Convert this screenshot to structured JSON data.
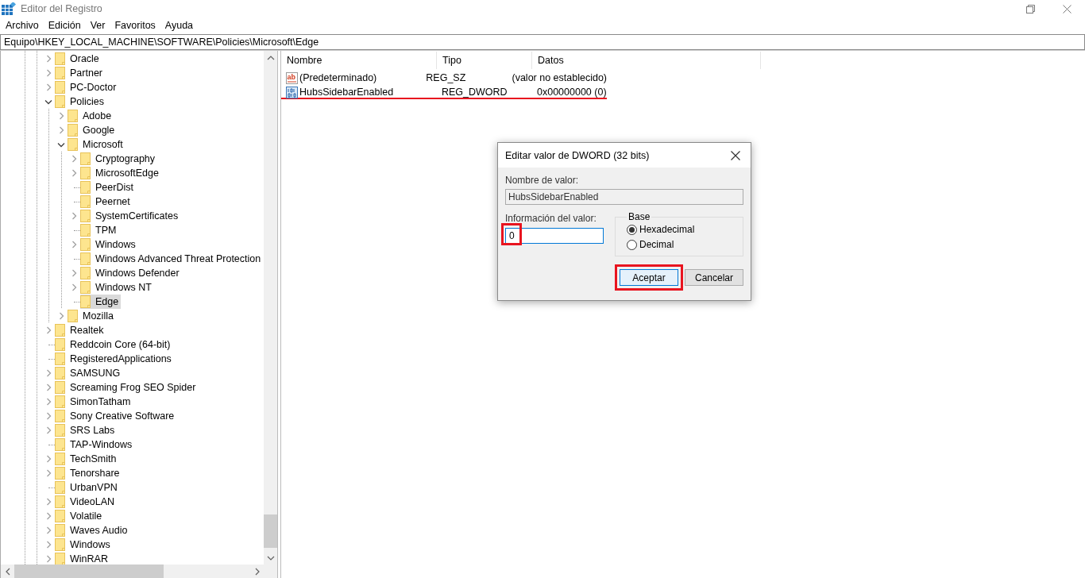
{
  "window": {
    "title": "Editor del Registro"
  },
  "menu": [
    "Archivo",
    "Edición",
    "Ver",
    "Favoritos",
    "Ayuda"
  ],
  "address": "Equipo\\HKEY_LOCAL_MACHINE\\SOFTWARE\\Policies\\Microsoft\\Edge",
  "tree": [
    {
      "label": "Oracle",
      "kind": "collapsed",
      "selected": false
    },
    {
      "label": "Partner",
      "kind": "collapsed",
      "selected": false
    },
    {
      "label": "PC-Doctor",
      "kind": "collapsed",
      "selected": false
    },
    {
      "label": "Policies",
      "kind": "expanded",
      "selected": false,
      "children": [
        {
          "label": "Adobe",
          "kind": "collapsed",
          "selected": false
        },
        {
          "label": "Google",
          "kind": "collapsed",
          "selected": false
        },
        {
          "label": "Microsoft",
          "kind": "expanded",
          "selected": false,
          "children": [
            {
              "label": "Cryptography",
              "kind": "collapsed",
              "selected": false
            },
            {
              "label": "MicrosoftEdge",
              "kind": "collapsed",
              "selected": false
            },
            {
              "label": "PeerDist",
              "kind": "leaf",
              "selected": false
            },
            {
              "label": "Peernet",
              "kind": "leaf",
              "selected": false
            },
            {
              "label": "SystemCertificates",
              "kind": "collapsed",
              "selected": false
            },
            {
              "label": "TPM",
              "kind": "leaf",
              "selected": false
            },
            {
              "label": "Windows",
              "kind": "collapsed",
              "selected": false
            },
            {
              "label": "Windows Advanced Threat Protection",
              "kind": "leaf",
              "selected": false
            },
            {
              "label": "Windows Defender",
              "kind": "collapsed",
              "selected": false
            },
            {
              "label": "Windows NT",
              "kind": "collapsed",
              "selected": false
            },
            {
              "label": "Edge",
              "kind": "leaf",
              "selected": true
            }
          ]
        },
        {
          "label": "Mozilla",
          "kind": "collapsed",
          "selected": false
        }
      ]
    },
    {
      "label": "Realtek",
      "kind": "collapsed",
      "selected": false
    },
    {
      "label": "Reddcoin Core (64-bit)",
      "kind": "leaf",
      "selected": false
    },
    {
      "label": "RegisteredApplications",
      "kind": "leaf",
      "selected": false
    },
    {
      "label": "SAMSUNG",
      "kind": "collapsed",
      "selected": false
    },
    {
      "label": "Screaming Frog SEO Spider",
      "kind": "collapsed",
      "selected": false
    },
    {
      "label": "SimonTatham",
      "kind": "collapsed",
      "selected": false
    },
    {
      "label": "Sony Creative Software",
      "kind": "collapsed",
      "selected": false
    },
    {
      "label": "SRS Labs",
      "kind": "collapsed",
      "selected": false
    },
    {
      "label": "TAP-Windows",
      "kind": "leaf",
      "selected": false
    },
    {
      "label": "TechSmith",
      "kind": "collapsed",
      "selected": false
    },
    {
      "label": "Tenorshare",
      "kind": "collapsed",
      "selected": false
    },
    {
      "label": "UrbanVPN",
      "kind": "leaf",
      "selected": false
    },
    {
      "label": "VideoLAN",
      "kind": "collapsed",
      "selected": false
    },
    {
      "label": "Volatile",
      "kind": "collapsed",
      "selected": false
    },
    {
      "label": "Waves Audio",
      "kind": "collapsed",
      "selected": false
    },
    {
      "label": "Windows",
      "kind": "collapsed",
      "selected": false
    },
    {
      "label": "WinRAR",
      "kind": "collapsed",
      "selected": false
    }
  ],
  "values": {
    "columns": [
      "Nombre",
      "Tipo",
      "Datos"
    ],
    "rows": [
      {
        "kind": "string",
        "icon_text": "ab",
        "name": "(Predeterminado)",
        "type": "REG_SZ",
        "data": "(valor no establecido)",
        "underlined": false
      },
      {
        "kind": "binary",
        "name": "HubsSidebarEnabled",
        "type": "REG_DWORD",
        "data": "0x00000000 (0)",
        "underlined": true
      }
    ]
  },
  "dialog": {
    "title": "Editar valor de DWORD (32 bits)",
    "name_label": "Nombre de valor:",
    "name_value": "HubsSidebarEnabled",
    "data_label": "Información del valor:",
    "data_value": "0",
    "data_highlighted": true,
    "base_label": "Base",
    "base_options": [
      {
        "label": "Hexadecimal",
        "selected": true
      },
      {
        "label": "Decimal",
        "selected": false
      }
    ],
    "buttons": [
      {
        "label": "Aceptar",
        "default": true,
        "highlighted": true
      },
      {
        "label": "Cancelar",
        "default": false,
        "highlighted": false
      }
    ]
  }
}
